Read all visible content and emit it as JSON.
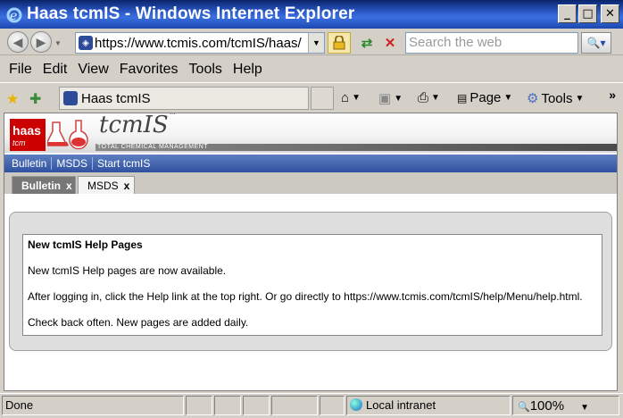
{
  "window": {
    "title": "Haas tcmIS - Windows Internet Explorer",
    "btn_minimize": "_",
    "btn_maximize": "□",
    "btn_close": "✕"
  },
  "address_bar": {
    "url": "https://www.tcmis.com/tcmIS/haas/"
  },
  "search": {
    "placeholder": "Search the web"
  },
  "menu": {
    "file": "File",
    "edit": "Edit",
    "view": "View",
    "favorites": "Favorites",
    "tools": "Tools",
    "help": "Help"
  },
  "command_bar": {
    "tab_label": "Haas tcmIS",
    "page_label": "Page",
    "tools_label": "Tools"
  },
  "site": {
    "logo_text": "haas",
    "logo_sub": "tcm",
    "brand": "tcmIS",
    "brand_tm": "™",
    "tagline": "TOTAL CHEMICAL MANAGEMENT",
    "links": [
      "Bulletin",
      "MSDS",
      "Start tcmIS"
    ],
    "tabs": [
      {
        "label": "Bulletin",
        "close": "x",
        "active": true
      },
      {
        "label": "MSDS",
        "close": "x",
        "active": false
      }
    ]
  },
  "bulletin": {
    "title": "New tcmIS Help Pages",
    "para1": "New tcmIS Help pages are now available.",
    "para2": "After logging in, click the Help link at the top right. Or go directly to https://www.tcmis.com/tcmIS/help/Menu/help.html.",
    "para3": "Check back often. New pages are added daily."
  },
  "status_bar": {
    "status": "Done",
    "zone": "Local intranet",
    "zoom": "100%"
  }
}
